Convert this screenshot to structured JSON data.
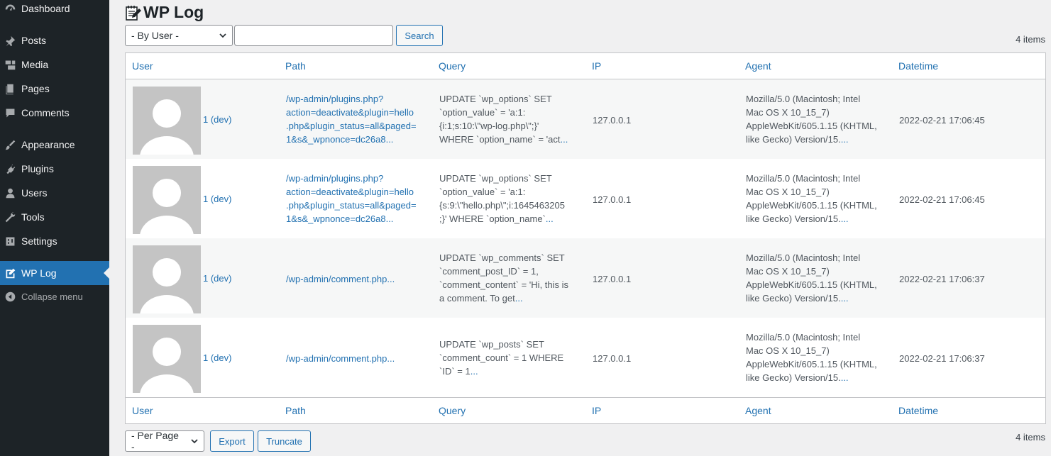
{
  "sidebar": {
    "items": [
      {
        "label": "Dashboard",
        "icon": "dashboard-icon"
      },
      {
        "label": "Posts",
        "icon": "pin-icon"
      },
      {
        "label": "Media",
        "icon": "media-icon"
      },
      {
        "label": "Pages",
        "icon": "pages-icon"
      },
      {
        "label": "Comments",
        "icon": "comment-icon"
      },
      {
        "label": "Appearance",
        "icon": "brush-icon"
      },
      {
        "label": "Plugins",
        "icon": "plug-icon"
      },
      {
        "label": "Users",
        "icon": "user-icon"
      },
      {
        "label": "Tools",
        "icon": "wrench-icon"
      },
      {
        "label": "Settings",
        "icon": "settings-icon"
      },
      {
        "label": "WP Log",
        "icon": "edit-icon",
        "active": true
      }
    ],
    "collapse_label": "Collapse menu"
  },
  "page": {
    "title": "WP Log",
    "filter_select": "- By User -",
    "search_value": "",
    "search_button": "Search",
    "items_count": "4 items",
    "per_page_select": "- Per Page -",
    "export_button": "Export",
    "truncate_button": "Truncate"
  },
  "table": {
    "columns": [
      "User",
      "Path",
      "Query",
      "IP",
      "Agent",
      "Datetime"
    ],
    "rows": [
      {
        "user": "1 (dev)",
        "path_lines": [
          "/wp-admin/plugins.php?",
          "action=deactivate&plugin=hello",
          ".php&plugin_status=all&paged=",
          "1&s&_wpnonce=dc26a8..."
        ],
        "query_lines": [
          "UPDATE `wp_options` SET",
          "`option_value` = 'a:1:",
          "{i:1;s:10:\\\"wp-log.php\\\";}'",
          "WHERE `option_name` = 'act"
        ],
        "ip": "127.0.0.1",
        "agent_lines": [
          "Mozilla/5.0 (Macintosh; Intel",
          "Mac OS X 10_15_7)",
          "AppleWebKit/605.1.15 (KHTML,",
          "like Gecko) Version/15."
        ],
        "datetime": "2022-02-21 17:06:45"
      },
      {
        "user": "1 (dev)",
        "path_lines": [
          "/wp-admin/plugins.php?",
          "action=deactivate&plugin=hello",
          ".php&plugin_status=all&paged=",
          "1&s&_wpnonce=dc26a8..."
        ],
        "query_lines": [
          "UPDATE `wp_options` SET",
          "`option_value` = 'a:1:",
          "{s:9:\\\"hello.php\\\";i:1645463205",
          ";}' WHERE `option_name`"
        ],
        "ip": "127.0.0.1",
        "agent_lines": [
          "Mozilla/5.0 (Macintosh; Intel",
          "Mac OS X 10_15_7)",
          "AppleWebKit/605.1.15 (KHTML,",
          "like Gecko) Version/15."
        ],
        "datetime": "2022-02-21 17:06:45"
      },
      {
        "user": "1 (dev)",
        "path_lines": [
          "/wp-admin/comment.php..."
        ],
        "query_lines": [
          "UPDATE `wp_comments` SET",
          "`comment_post_ID` = 1,",
          "`comment_content` = 'Hi, this is",
          "a comment. To get"
        ],
        "ip": "127.0.0.1",
        "agent_lines": [
          "Mozilla/5.0 (Macintosh; Intel",
          "Mac OS X 10_15_7)",
          "AppleWebKit/605.1.15 (KHTML,",
          "like Gecko) Version/15."
        ],
        "datetime": "2022-02-21 17:06:37"
      },
      {
        "user": "1 (dev)",
        "path_lines": [
          "/wp-admin/comment.php..."
        ],
        "query_lines": [
          "UPDATE `wp_posts` SET",
          "`comment_count` = 1 WHERE",
          "`ID` = 1"
        ],
        "ip": "127.0.0.1",
        "agent_lines": [
          "Mozilla/5.0 (Macintosh; Intel",
          "Mac OS X 10_15_7)",
          "AppleWebKit/605.1.15 (KHTML,",
          "like Gecko) Version/15."
        ],
        "datetime": "2022-02-21 17:06:37"
      }
    ],
    "ellipsis": "..."
  },
  "colors": {
    "sidebar_bg": "#1d2327",
    "accent": "#2271b1",
    "page_bg": "#f0f0f1"
  }
}
